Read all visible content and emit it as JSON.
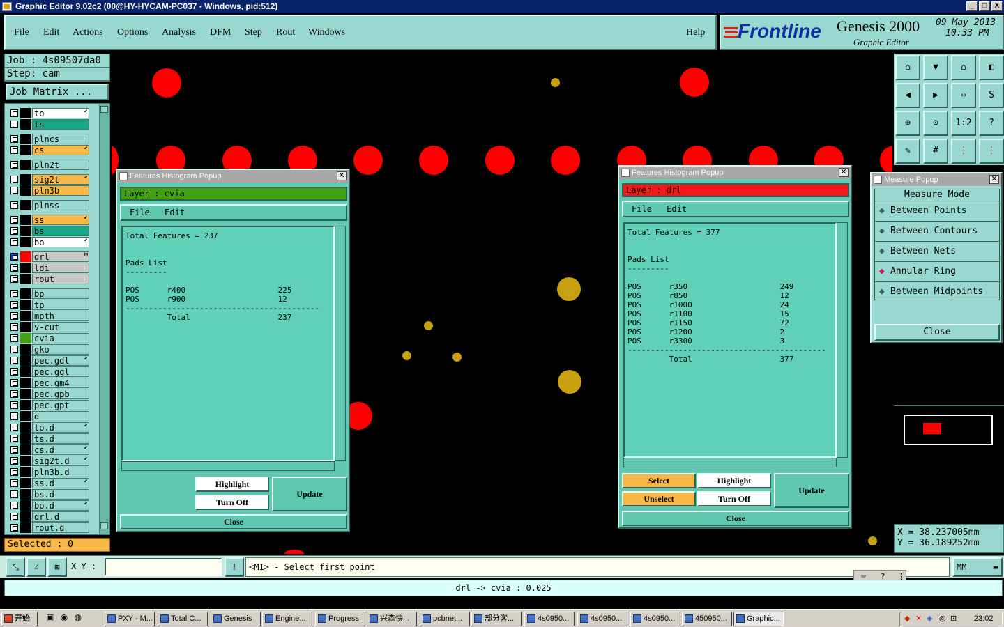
{
  "window": {
    "title": "Graphic Editor 9.02c2 (00@HY-HYCAM-PC037 - Windows, pid:512)",
    "min_glyph": "_",
    "max_glyph": "□",
    "close_glyph": "X"
  },
  "menu": {
    "file": "File",
    "edit": "Edit",
    "actions": "Actions",
    "options": "Options",
    "analysis": "Analysis",
    "dfm": "DFM",
    "step": "Step",
    "rout": "Rout",
    "windows": "Windows",
    "help": "Help"
  },
  "brand": {
    "company": "Frontline",
    "product": "Genesis 2000",
    "subtitle": "Graphic Editor",
    "date": "09 May 2013",
    "time": "10:33 PM"
  },
  "job": {
    "job_line": "Job : 4s09507da0",
    "step_line": "Step: cam",
    "matrix_label": "Job Matrix ..."
  },
  "layers": [
    {
      "name": "to",
      "color": "#ffffff",
      "mark": "⬋"
    },
    {
      "name": "ts",
      "color": "#18a888",
      "mark": ""
    },
    {
      "name": "plncs",
      "color": "#98d8d0",
      "mark": ""
    },
    {
      "name": "cs",
      "color": "#f8b848",
      "mark": "⬋"
    },
    {
      "name": "pln2t",
      "color": "#98d8d0",
      "mark": ""
    },
    {
      "name": "sig2t",
      "color": "#f8b848",
      "mark": "⬋"
    },
    {
      "name": "pln3b",
      "color": "#f8b848",
      "mark": ""
    },
    {
      "name": "plnss",
      "color": "#98d8d0",
      "mark": ""
    },
    {
      "name": "ss",
      "color": "#f8b848",
      "mark": "⬋"
    },
    {
      "name": "bs",
      "color": "#18a888",
      "mark": ""
    },
    {
      "name": "bo",
      "color": "#ffffff",
      "mark": "⬋"
    },
    {
      "name": "drl",
      "color": "#c8c8c8",
      "mark": "⊞"
    },
    {
      "name": "ldi",
      "color": "#c8c8c8",
      "mark": ""
    },
    {
      "name": "rout",
      "color": "#c8c8c8",
      "mark": ""
    },
    {
      "name": "bp",
      "color": "#98d8d0",
      "mark": ""
    },
    {
      "name": "tp",
      "color": "#98d8d0",
      "mark": ""
    },
    {
      "name": "mpth",
      "color": "#98d8d0",
      "mark": ""
    },
    {
      "name": "v-cut",
      "color": "#98d8d0",
      "mark": ""
    },
    {
      "name": "cvia",
      "color": "#98d8d0",
      "mark": ""
    },
    {
      "name": "gko",
      "color": "#98d8d0",
      "mark": ""
    },
    {
      "name": "pec.gdl",
      "color": "#98d8d0",
      "mark": "⬋"
    },
    {
      "name": "pec.ggl",
      "color": "#98d8d0",
      "mark": ""
    },
    {
      "name": "pec.gm4",
      "color": "#98d8d0",
      "mark": ""
    },
    {
      "name": "pec.gpb",
      "color": "#98d8d0",
      "mark": ""
    },
    {
      "name": "pec.gpt",
      "color": "#98d8d0",
      "mark": ""
    },
    {
      "name": "d",
      "color": "#98d8d0",
      "mark": ""
    },
    {
      "name": "to.d",
      "color": "#98d8d0",
      "mark": "⬋"
    },
    {
      "name": "ts.d",
      "color": "#98d8d0",
      "mark": ""
    },
    {
      "name": "cs.d",
      "color": "#98d8d0",
      "mark": "⬋"
    },
    {
      "name": "sig2t.d",
      "color": "#98d8d0",
      "mark": "⬋"
    },
    {
      "name": "pln3b.d",
      "color": "#98d8d0",
      "mark": ""
    },
    {
      "name": "ss.d",
      "color": "#98d8d0",
      "mark": "⬋"
    },
    {
      "name": "bs.d",
      "color": "#98d8d0",
      "mark": ""
    },
    {
      "name": "bo.d",
      "color": "#98d8d0",
      "mark": "⬋"
    },
    {
      "name": "drl.d",
      "color": "#98d8d0",
      "mark": ""
    },
    {
      "name": "rout.d",
      "color": "#98d8d0",
      "mark": ""
    }
  ],
  "selected": "Selected : 0",
  "hist1": {
    "title": "Features Histogram Popup",
    "layer_label": "Layer :  cvia",
    "layer_color": "#40a010",
    "menu_file": "File",
    "menu_edit": "Edit",
    "lines": [
      "Total Features = 237",
      "",
      "",
      "Pads List",
      "---------",
      "",
      "POS      r400                    225",
      "POS      r900                    12",
      "------------------------------------------",
      "         Total                   237"
    ],
    "highlight": "Highlight",
    "turn_off": "Turn Off",
    "update": "Update",
    "close": "Close"
  },
  "hist2": {
    "title": "Features Histogram Popup",
    "layer_label": "Layer :  drl",
    "layer_color": "#f01818",
    "menu_file": "File",
    "menu_edit": "Edit",
    "lines": [
      "Total Features = 377",
      "",
      "",
      "Pads List",
      "---------",
      "",
      "POS      r350                    249",
      "POS      r850                    12",
      "POS      r1000                   24",
      "POS      r1100                   15",
      "POS      r1150                   72",
      "POS      r1200                   2",
      "POS      r3300                   3",
      "-------------------------------------------",
      "         Total                   377"
    ],
    "select": "Select",
    "unselect": "Unselect",
    "highlight": "Highlight",
    "turn_off": "Turn Off",
    "update": "Update",
    "close": "Close"
  },
  "measure": {
    "title": "Measure Popup",
    "mode_label": "Measure Mode",
    "options": [
      "Between Points",
      "Between Contours",
      "Between Nets",
      "Annular Ring",
      "Between Midpoints"
    ],
    "selected_index": 3,
    "close": "Close"
  },
  "coords": {
    "x": "X  =  38.237005mm",
    "y": "Y  =  36.189252mm"
  },
  "toolbar": {
    "one_to_two": "1:2",
    "question": "?"
  },
  "command": {
    "xy_label": "X Y :",
    "xy_value": "",
    "prompt": "<M1> - Select first point",
    "units": "MM",
    "bang": "!"
  },
  "message": "drl -> cvia : 0.025",
  "colors": {
    "panel": "#98d8d0",
    "accent_orange": "#f8b848",
    "drill_red": "#ff0000",
    "via_gold": "#c8a010"
  },
  "taskbar": {
    "start": "开始",
    "items": [
      "PXY - M...",
      "Total C...",
      "Genesis",
      "Engine...",
      "Progress",
      "兴森快...",
      "pcbnet...",
      "部分客...",
      "4s0950...",
      "4s0950...",
      "4s0950...",
      "450950...",
      "Graphic..."
    ],
    "clock": "23:02"
  }
}
